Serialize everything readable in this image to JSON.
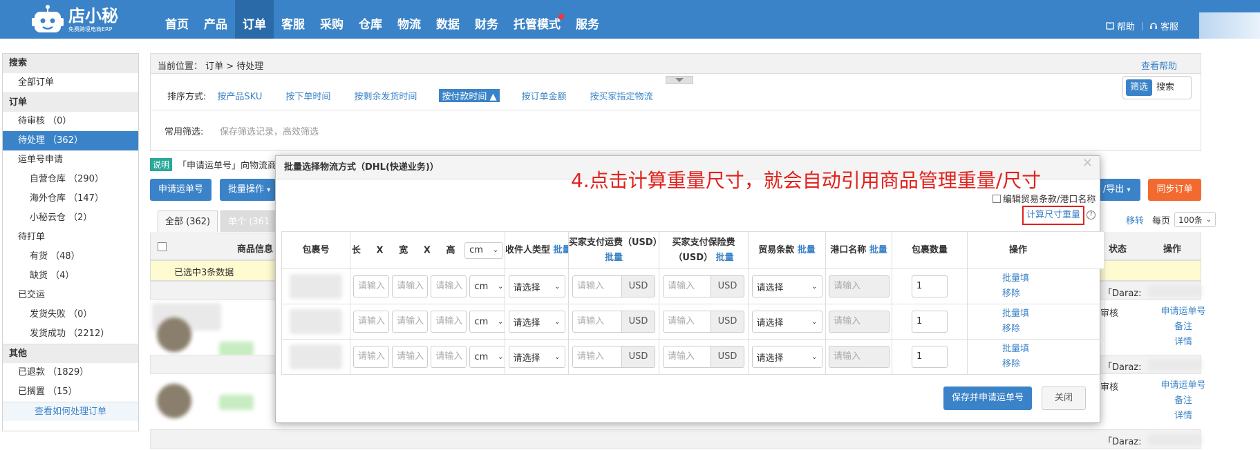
{
  "header": {
    "logo_text": "店小秘",
    "logo_sub": "免费跨境电商ERP",
    "nav": [
      "首页",
      "产品",
      "订单",
      "客服",
      "采购",
      "仓库",
      "物流",
      "数据",
      "财务",
      "托管模式",
      "服务"
    ],
    "help": "帮助",
    "service": "客服"
  },
  "sidebar": {
    "search_head": "搜索",
    "all_orders": "全部订单",
    "order_head": "订单",
    "pending_review": "待审核 （0）",
    "pending_process": "待处理 （362）",
    "waybill_apply": "运单号申请",
    "own_warehouse": "自营仓库 （290）",
    "overseas_warehouse": "海外仓库 （147）",
    "xiaomi_warehouse": "小秘云仓 （2）",
    "to_print": "待打单",
    "in_stock": "有货 （48）",
    "out_of_stock": "缺货 （4）",
    "shipped": "已交运",
    "ship_failed": "发货失败 （0）",
    "ship_success": "发货成功 （2212）",
    "other_head": "其他",
    "refunded": "已退款 （1829）",
    "shelved": "已搁置 （15）",
    "how_to": "查看如何处理订单"
  },
  "main": {
    "breadcrumb": "当前位置： 订单 > 待处理",
    "help_link": "查看帮助",
    "sort_label": "排序方式:",
    "sort_options": [
      "按产品SKU",
      "按下单时间",
      "按剩余发货时间",
      "按付款时间 ▲",
      "按订单金额",
      "按买家指定物流"
    ],
    "common_filter_label": "常用筛选:",
    "common_filter_hint": "保存筛选记录，高效筛选",
    "filter_btn": "筛选",
    "search_btn": "搜索",
    "explain_tag": "说明",
    "explain_text": "「申请运单号」向物流商",
    "apply_btn": "申请运单号",
    "batch_btn": "批量操作",
    "export_btn": "/导出",
    "sync_btn": "同步订单",
    "tab_all": "全部 (362)",
    "tab_single": "单个 (361",
    "move_link": "移转",
    "per_page_label": "每页",
    "per_page_value": "100条",
    "col_goods": "商品信息",
    "col_status": "状态",
    "col_ops": "操作",
    "selected_text": "已选中3条数据",
    "order_tag": "「Daraz:",
    "status_review": "审核",
    "op_apply": "申请运单号",
    "op_note": "备注",
    "op_detail": "详情"
  },
  "modal": {
    "title": "批量选择物流方式（DHL(快递业务)）",
    "close": "×",
    "annotation": "4.点击计算重量尺寸，就会自动引用商品管理重量/尺寸",
    "edit_trade_label": "编辑贸易条款/港口名称",
    "calc_btn": "计算尺寸重量",
    "help_icon": "?",
    "headers": {
      "package_no": "包裹号",
      "dims_l": "长",
      "dims_x": "X",
      "dims_w": "宽",
      "dims_h": "高",
      "unit": "cm",
      "recipient": "收件人类型",
      "shipping_fee": "买家支付运费（USD）",
      "insurance_fee": "买家支付保险费",
      "insurance_unit": "（USD）",
      "trade_terms": "贸易条款",
      "port": "港口名称",
      "pkg_count": "包裹数量",
      "ops": "操作",
      "batch": "批量"
    },
    "row": {
      "placeholder": "请输入",
      "unit": "cm",
      "select_placeholder": "请选择",
      "currency": "USD",
      "count": "1",
      "op_batch": "批量填",
      "op_remove": "移除"
    },
    "save_btn": "保存并申请运单号",
    "close_btn": "关闭"
  },
  "colors": {
    "brand": "#3b83c8",
    "accent": "#f36a30",
    "annotation": "#e2211c"
  }
}
